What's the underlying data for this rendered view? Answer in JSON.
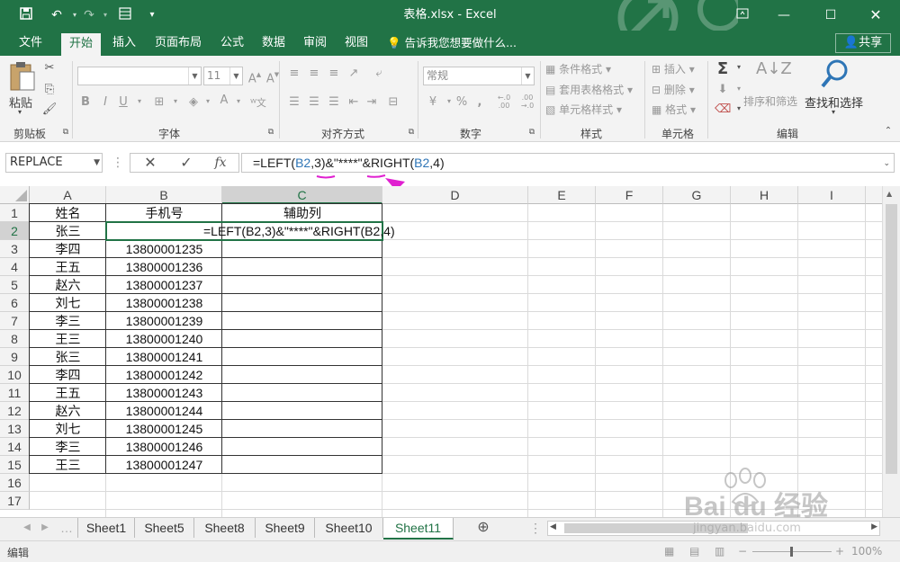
{
  "window": {
    "title": "表格.xlsx - Excel"
  },
  "tabs": [
    "文件",
    "开始",
    "插入",
    "页面布局",
    "公式",
    "数据",
    "审阅",
    "视图"
  ],
  "active_tab": "开始",
  "tell_me": "告诉我您想要做什么...",
  "share": "共享",
  "ribbon": {
    "paste": "粘贴",
    "group_clipboard": "剪贴板",
    "group_font": "字体",
    "font_size": "11",
    "group_align": "对齐方式",
    "number_format": "常规",
    "group_number": "数字",
    "conditional_format": "条件格式",
    "table_format": "套用表格格式",
    "cell_style": "单元格样式",
    "group_style": "样式",
    "insert": "插入",
    "delete": "删除",
    "format": "格式",
    "group_cells": "单元格",
    "sort_filter": "排序和筛选",
    "find_select": "查找和选择",
    "group_edit": "编辑",
    "bold": "B",
    "italic": "I",
    "underline": "U"
  },
  "formula_bar": {
    "name_box": "REPLACE",
    "formula_prefix": "=LEFT(",
    "ref1": "B2",
    "formula_mid": ",3)&\"****\"&RIGHT(",
    "ref2": "B2",
    "formula_suffix": ",4)"
  },
  "columns": [
    "A",
    "B",
    "C",
    "D",
    "E",
    "F",
    "G",
    "H",
    "I"
  ],
  "rows": [
    "1",
    "2",
    "3",
    "4",
    "5",
    "6",
    "7",
    "8",
    "9",
    "10",
    "11",
    "12",
    "13",
    "14",
    "15",
    "16",
    "17"
  ],
  "headers": {
    "name": "姓名",
    "phone": "手机号",
    "helper": "辅助列"
  },
  "edit_formula": "=LEFT(B2,3)&\"****\"&RIGHT(B2,4)",
  "data_rows": [
    {
      "name": "张三",
      "phone": ""
    },
    {
      "name": "李四",
      "phone": "13800001235"
    },
    {
      "name": "王五",
      "phone": "13800001236"
    },
    {
      "name": "赵六",
      "phone": "13800001237"
    },
    {
      "name": "刘七",
      "phone": "13800001238"
    },
    {
      "name": "李三",
      "phone": "13800001239"
    },
    {
      "name": "王三",
      "phone": "13800001240"
    },
    {
      "name": "张三",
      "phone": "13800001241"
    },
    {
      "name": "李四",
      "phone": "13800001242"
    },
    {
      "name": "王五",
      "phone": "13800001243"
    },
    {
      "name": "赵六",
      "phone": "13800001244"
    },
    {
      "name": "刘七",
      "phone": "13800001245"
    },
    {
      "name": "李三",
      "phone": "13800001246"
    },
    {
      "name": "王三",
      "phone": "13800001247"
    }
  ],
  "sheets": [
    "Sheet1",
    "Sheet5",
    "Sheet8",
    "Sheet9",
    "Sheet10",
    "Sheet11"
  ],
  "active_sheet": "Sheet11",
  "status": {
    "mode": "编辑",
    "zoom": "100%"
  },
  "watermark": {
    "brand": "Bai du 经验",
    "url": "jingyan.baidu.com"
  },
  "colors": {
    "excel_green": "#217346",
    "annotation": "#e020d0"
  }
}
